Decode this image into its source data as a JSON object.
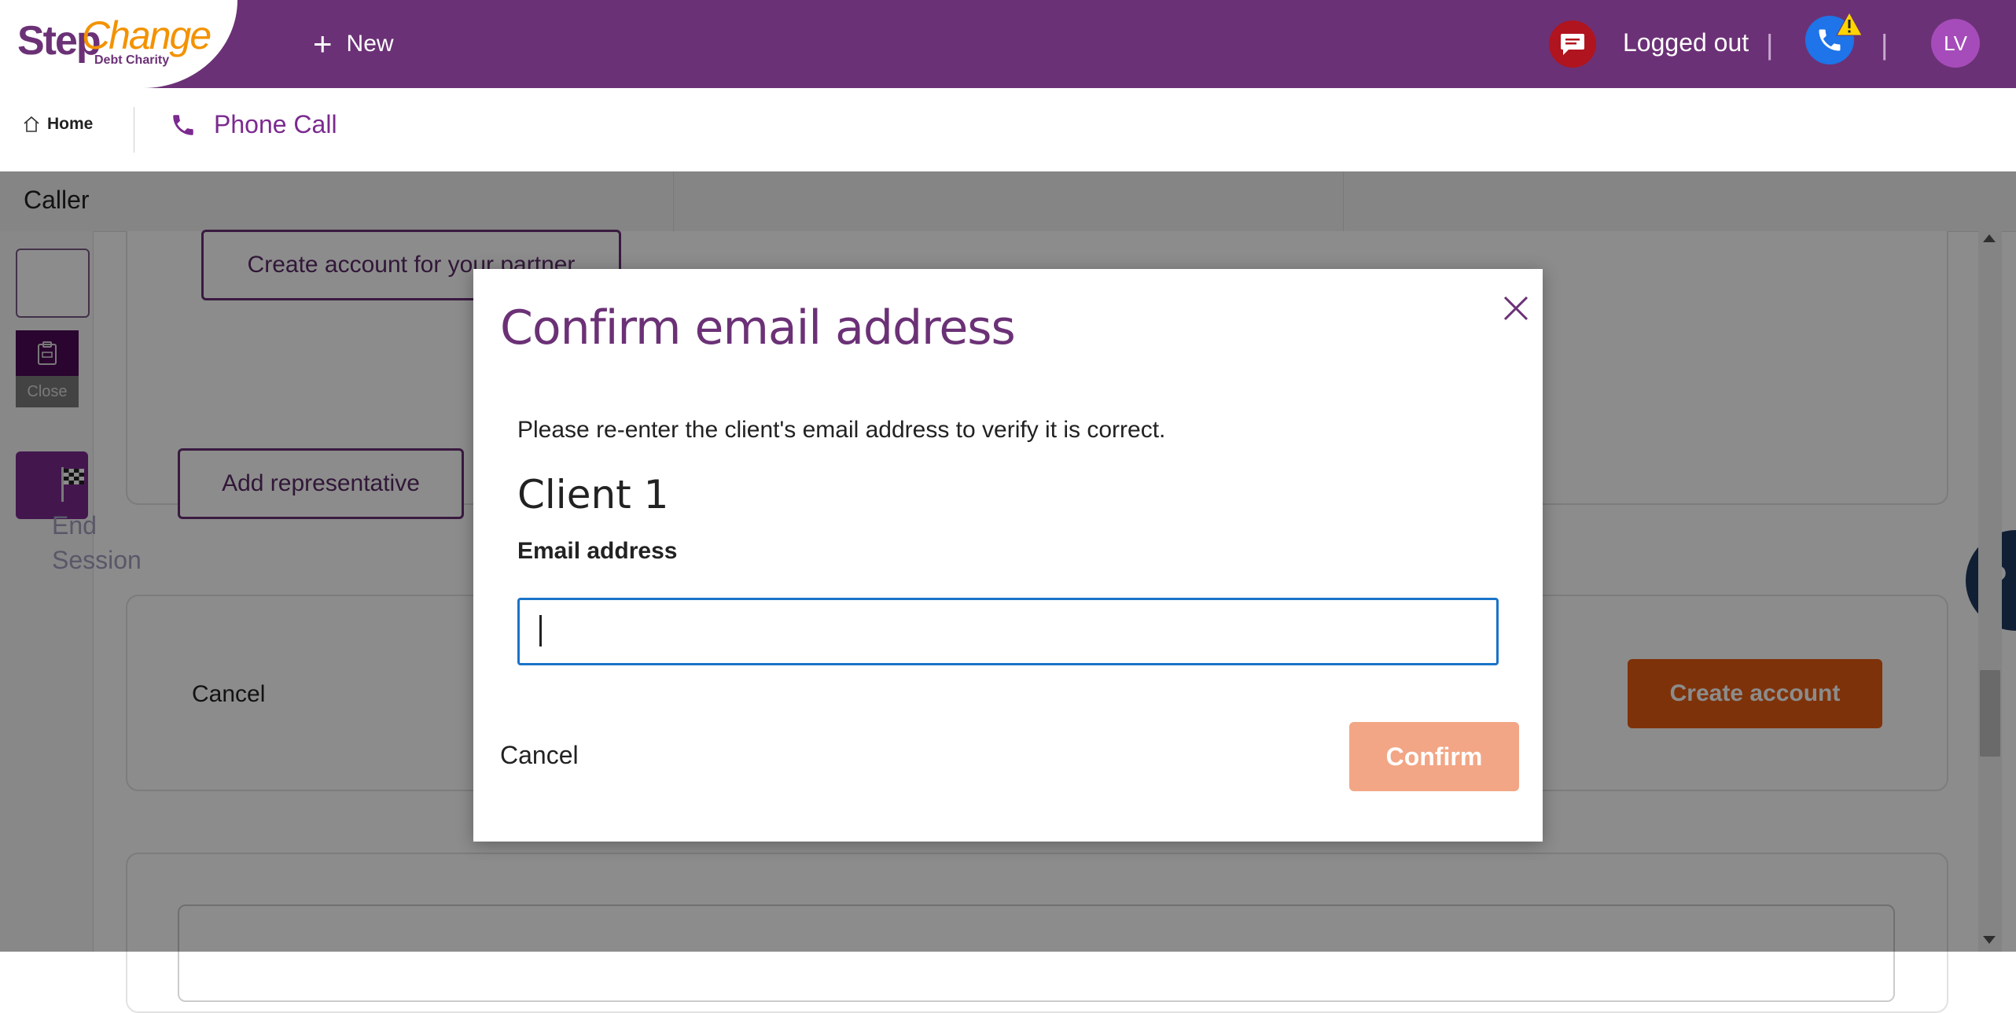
{
  "header": {
    "logo": {
      "step": "Step",
      "change": "Change",
      "sub": "Debt Charity"
    },
    "new_label": "New",
    "status_text": "Logged out",
    "separator": "|",
    "avatar_initials": "LV",
    "colors": {
      "bar": "#6b3176",
      "chat_icon": "#b0141e",
      "phone_icon": "#1e74e8",
      "avatar": "#a54cba"
    }
  },
  "nav": {
    "home_label": "Home",
    "phone_tab_label": "Phone Call"
  },
  "page": {
    "caller_label": "Caller",
    "rail": {
      "close_label": "Close",
      "end_session_label": "End\nSession"
    },
    "partner_button": "Create account for your partner",
    "representative_button": "Add representative",
    "cancel_label": "Cancel",
    "create_account_label": "Create account",
    "help_label": "?",
    "colors": {
      "create_account": "#e55b12"
    }
  },
  "modal": {
    "title": "Confirm email address",
    "description": "Please re-enter the client's email address to verify it is correct.",
    "client_heading": "Client 1",
    "email_label": "Email address",
    "email_value": "",
    "cancel_label": "Cancel",
    "confirm_label": "Confirm",
    "colors": {
      "title": "#6b3176",
      "confirm": "#f2a685",
      "input_border": "#1a73c8"
    }
  },
  "icons": {
    "chat": "chat-bubble-icon",
    "phone": "phone-icon",
    "warning": "warning-icon",
    "home": "home-icon",
    "close": "close-icon",
    "clipboard": "clipboard-icon",
    "flag": "checkered-flag-icon"
  }
}
